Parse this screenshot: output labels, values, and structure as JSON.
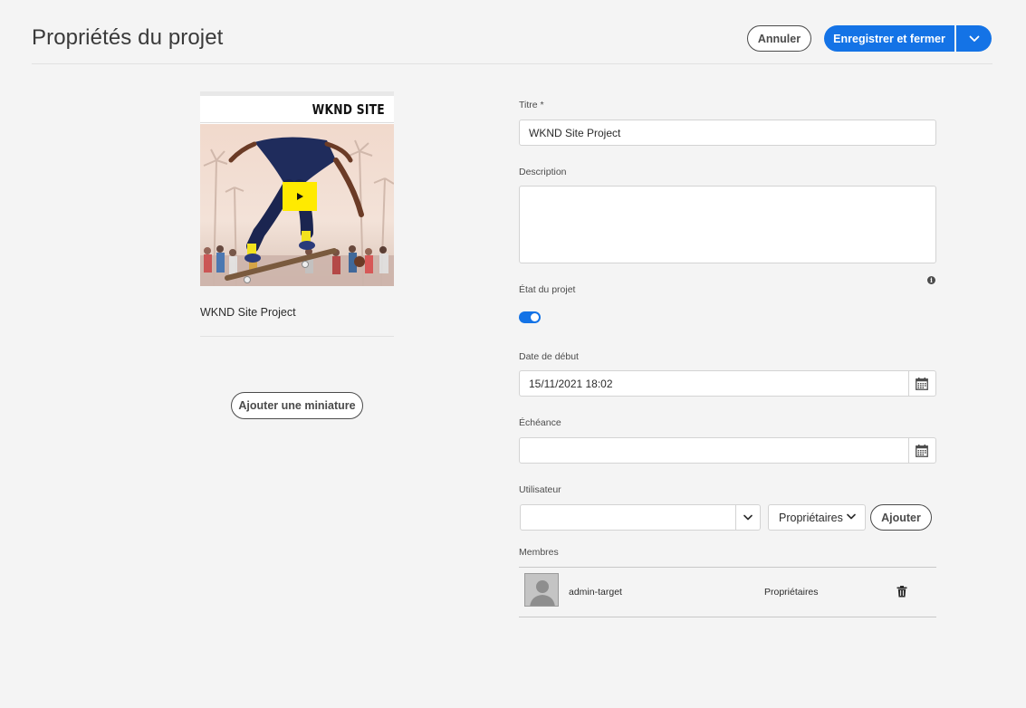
{
  "header": {
    "title": "Propriétés du projet",
    "cancel_label": "Annuler",
    "save_label": "Enregistrer et fermer"
  },
  "thumbnail": {
    "brand_text": "WKND SITE",
    "caption": "WKND Site Project",
    "add_thumbnail_label": "Ajouter une miniature"
  },
  "form": {
    "title_label": "Titre *",
    "title_value": "WKND Site Project",
    "description_label": "Description",
    "description_value": "",
    "status_label": "État du projet",
    "status_on": true,
    "start_date_label": "Date de début",
    "start_date_value": "15/11/2021 18:02",
    "due_date_label": "Échéance",
    "due_date_value": "",
    "user_label": "Utilisateur",
    "user_value": "",
    "role_selected": "Propriétaires",
    "add_label": "Ajouter",
    "members_label": "Membres"
  },
  "members": [
    {
      "name": "admin-target",
      "role": "Propriétaires"
    }
  ],
  "colors": {
    "accent": "#1473e6",
    "background": "#f4f4f4",
    "play_button": "#ffea00"
  },
  "icons": {
    "save_more": "chevron-down-icon",
    "calendar": "calendar-icon",
    "info": "info-icon",
    "delete": "trash-icon",
    "play": "play-icon"
  }
}
